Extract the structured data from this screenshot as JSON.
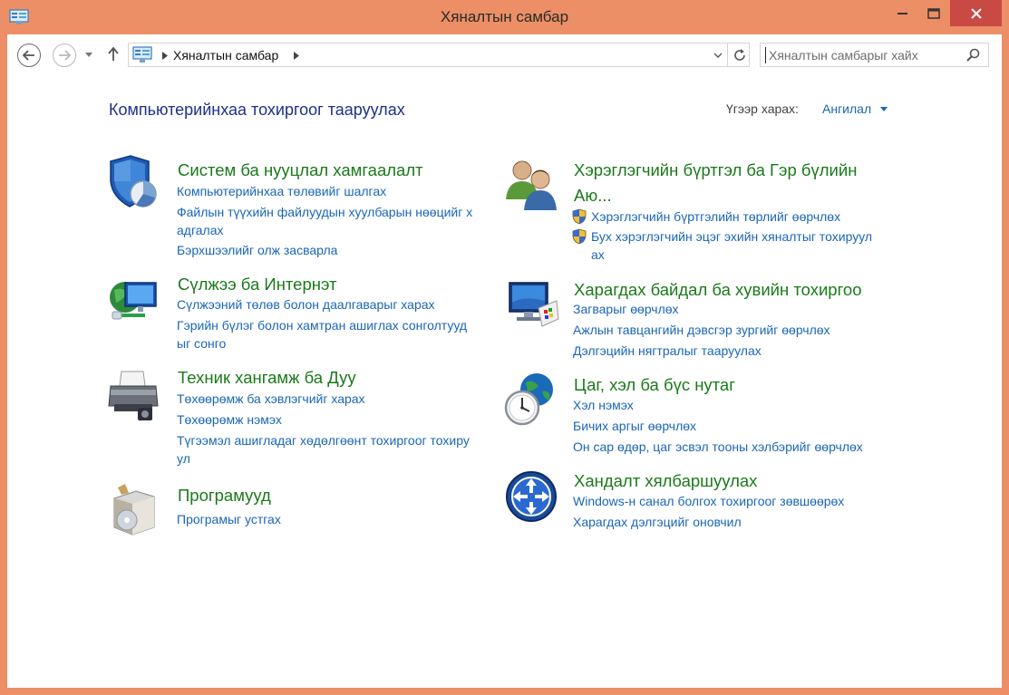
{
  "window": {
    "title": "Хяналтын самбар",
    "colors": {
      "accent": "#ec8e66",
      "close": "#c94a44",
      "link": "#1a66b8",
      "category": "#1a7a1a",
      "heading": "#1e3287"
    }
  },
  "addressbar": {
    "crumb": "Хяналтын самбар",
    "search_placeholder": "Хяналтын самбарыг хайх"
  },
  "main": {
    "title": "Компьютерийнхаа тохиргоог тааруулах",
    "view_by_label": "Үгээр харах:",
    "view_by_value": "Ангилал"
  },
  "categories": {
    "system": {
      "icon": "shield-pie-icon",
      "title": "Систем ба нууцлал хамгаалалт",
      "links": [
        "Компьютерийнхаа төлөвийг шалгах",
        "Файлын түүхийн файлуудын хуулбарын нөөцийг х",
        "адгалах",
        "Бэрхшээлийг олж засварла"
      ]
    },
    "network": {
      "icon": "globe-network-icon",
      "title": "Сүлжээ ба Интернэт",
      "links": [
        "Сүлжээний төлөв болон даалгаварыг харах",
        "Гэрийн бүлэг болон хамтран ашиглах сонголтууд",
        "ыг сонго"
      ]
    },
    "hardware": {
      "icon": "printer-icon",
      "title": "Техник хангамж ба Дуу",
      "links": [
        "Төхөөрөмж ба хэвлэгчийг харах",
        "Төхөөрөмж нэмэх",
        "Түгээмэл ашигладаг хөдөлгөөнт тохиргоог тохиру",
        "ул"
      ]
    },
    "programs": {
      "icon": "programs-box-icon",
      "title": "Програмууд",
      "links": [
        "Програмыг устгах"
      ]
    },
    "users": {
      "icon": "users-icon",
      "title_line1": "Хэрэглэгчийн бүртгэл ба Гэр бүлийн",
      "title_line2": "Аю...",
      "links": [
        "Хэрэглэгчийн бүртгэлийн төрлийг өөрчлөх",
        "Бух хэрэглэгчийн эцэг эхийн хяналтыг тохируул",
        "ах"
      ]
    },
    "appearance": {
      "icon": "monitor-palette-icon",
      "title": "Харагдах байдал ба хувийн тохиргоо",
      "links": [
        "Загварыг өөрчлөх",
        "Ажлын тавцангийн дэвсгэр зургийг өөрчлөх",
        "Дэлгэцийн нягтралыг тааруулах"
      ]
    },
    "clock": {
      "icon": "clock-globe-icon",
      "title": "Цаг, хэл ба бүс нутаг",
      "links": [
        "Хэл нэмэх",
        "Бичих аргыг өөрчлөх",
        "Он сар өдөр, цаг эсвэл тооны хэлбэрийг өөрчлөх"
      ]
    },
    "ease": {
      "icon": "ease-of-access-icon",
      "title": "Хандалт хялбаршуулах",
      "links": [
        "Windows-н санал болгох тохиргоог зөвшөөрөх",
        "Харагдах дэлгэцийг оновчил"
      ]
    }
  }
}
